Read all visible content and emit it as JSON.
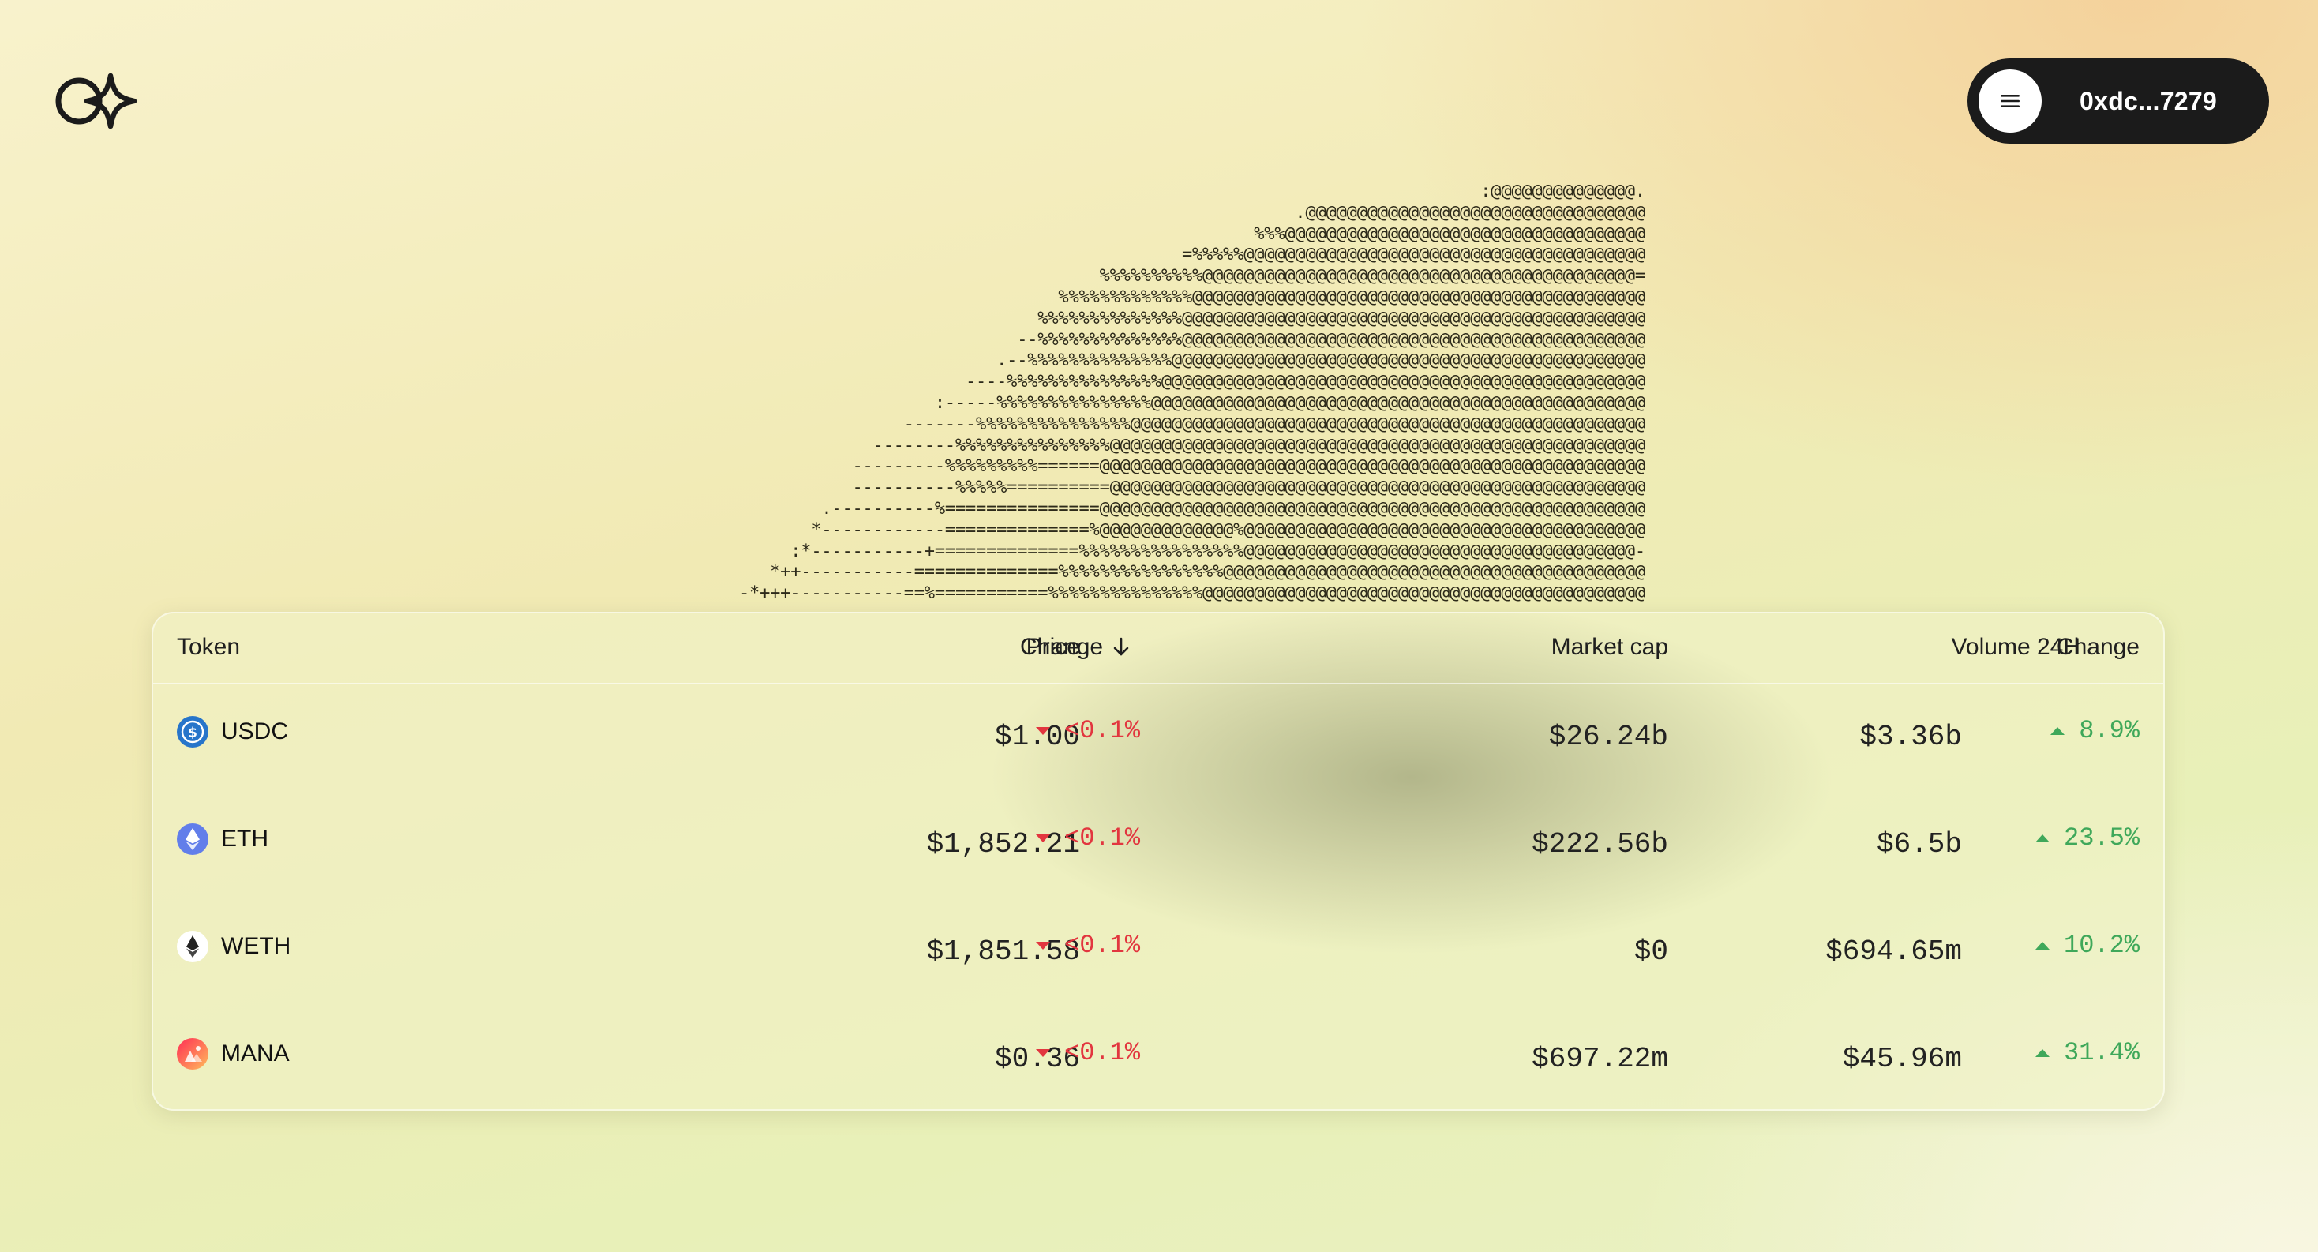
{
  "header": {
    "logo_icon": "infinity-star-logo-icon",
    "wallet": {
      "menu_icon": "hamburger-menu-icon",
      "address": "0xdc...7279"
    }
  },
  "ascii_art": [
    ":@@@@@@@@@@@@@@.",
    ".@@@@@@@@@@@@@@@@@@@@@@@@@@@@@@@@@",
    "%%%@@@@@@@@@@@@@@@@@@@@@@@@@@@@@@@@@@@",
    "=%%%%%@@@@@@@@@@@@@@@@@@@@@@@@@@@@@@@@@@@@@@@",
    "%%%%%%%%%%@@@@@@@@@@@@@@@@@@@@@@@@@@@@@@@@@@@@@@@@@@=",
    "%%%%%%%%%%%%%@@@@@@@@@@@@@@@@@@@@@@@@@@@@@@@@@@@@@@@@@@@@",
    "%%%%%%%%%%%%%%@@@@@@@@@@@@@@@@@@@@@@@@@@@@@@@@@@@@@@@@@@@@@",
    "--%%%%%%%%%%%%%%@@@@@@@@@@@@@@@@@@@@@@@@@@@@@@@@@@@@@@@@@@@@@",
    ".--%%%%%%%%%%%%%%@@@@@@@@@@@@@@@@@@@@@@@@@@@@@@@@@@@@@@@@@@@@@@",
    "----%%%%%%%%%%%%%%%@@@@@@@@@@@@@@@@@@@@@@@@@@@@@@@@@@@@@@@@@@@@@@@",
    ":-----%%%%%%%%%%%%%%%@@@@@@@@@@@@@@@@@@@@@@@@@@@@@@@@@@@@@@@@@@@@@@@@",
    "-------%%%%%%%%%%%%%%%@@@@@@@@@@@@@@@@@@@@@@@@@@@@@@@@@@@@@@@@@@@@@@@@@@",
    "--------%%%%%%%%%%%%%%%@@@@@@@@@@@@@@@@@@@@@@@@@@@@@@@@@@@@@@@@@@@@@@@@@@@@",
    "---------%%%%%%%%%======@@@@@@@@@@@@@@@@@@@@@@@@@@@@@@@@@@@@@@@@@@@@@@@@@@@@@",
    "----------%%%%%==========@@@@@@@@@@@@@@@@@@@@@@@@@@@@@@@@@@@@@@@@@@@@@@@@@@@@",
    ".----------%===============@@@@@@@@@@@@@@@@@@@@@@@@@@@@@@@@@@@@@@@@@@@@@@@@@@@@@",
    "*------------==============%@@@@@@@@@@@@@%@@@@@@@@@@@@@@@@@@@@@@@@@@@@@@@@@@@@@@@",
    ":*-----------+==============%%%%%%%%%%%%%%%%@@@@@@@@@@@@@@@@@@@@@@@@@@@@@@@@@@@@@@-",
    "*++-----------==============%%%%%%%%%%%%%%%%@@@@@@@@@@@@@@@@@@@@@@@@@@@@@@@@@@@@@@@@@",
    "-*+++-----------==%===========%%%%%%%%%%%%%%%@@@@@@@@@@@@@@@@@@@@@@@@@@@@@@@@@@@@@@@@@@@"
  ],
  "table": {
    "columns": {
      "token": "Token",
      "price": "Price",
      "change": "Change",
      "change_sort_icon": "arrow-down-icon",
      "market_cap": "Market cap",
      "volume": "Volume 24H",
      "volume_change": "Change"
    },
    "rows": [
      {
        "token": "USDC",
        "icon": "usdc-icon",
        "price": "$1.00",
        "change": "<0.1%",
        "change_dir": "down",
        "market_cap": "$26.24b",
        "volume": "$3.36b",
        "volume_change": "8.9%",
        "volume_change_dir": "up"
      },
      {
        "token": "ETH",
        "icon": "eth-icon",
        "price": "$1,852.21",
        "change": "<0.1%",
        "change_dir": "down",
        "market_cap": "$222.56b",
        "volume": "$6.5b",
        "volume_change": "23.5%",
        "volume_change_dir": "up"
      },
      {
        "token": "WETH",
        "icon": "weth-icon",
        "price": "$1,851.58",
        "change": "<0.1%",
        "change_dir": "down",
        "market_cap": "$0",
        "volume": "$694.65m",
        "volume_change": "10.2%",
        "volume_change_dir": "up"
      },
      {
        "token": "MANA",
        "icon": "mana-icon",
        "price": "$0.36",
        "change": "<0.1%",
        "change_dir": "down",
        "market_cap": "$697.22m",
        "volume": "$45.96m",
        "volume_change": "31.4%",
        "volume_change_dir": "up"
      }
    ]
  },
  "colors": {
    "negative": "#e2363f",
    "positive": "#3fa85a",
    "usdc": "#2775ca",
    "eth": "#627eea",
    "mana_start": "#ff2d55",
    "mana_end": "#ffbc5b"
  }
}
